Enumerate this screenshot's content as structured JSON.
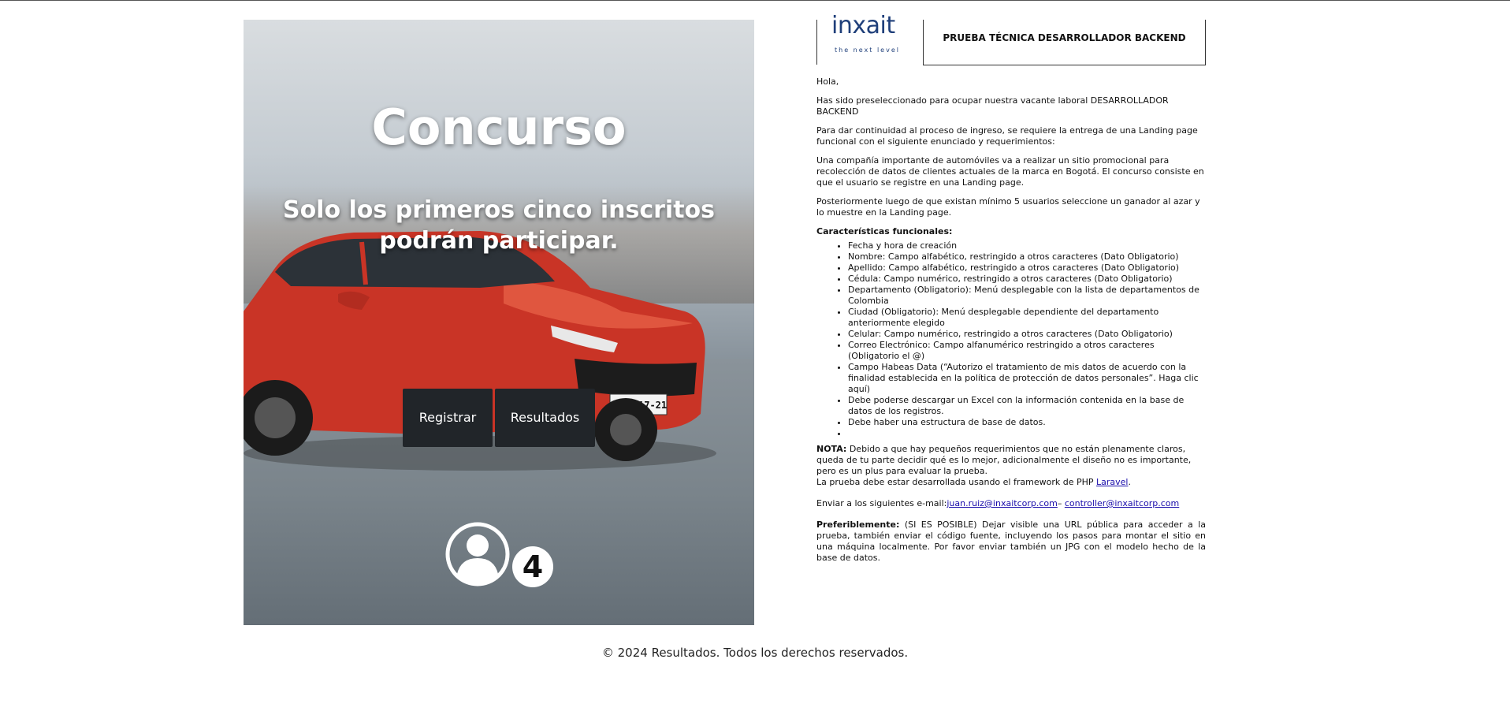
{
  "hero": {
    "title": "Concurso",
    "subtitle": "Solo los primeros cinco inscritos podrán participar.",
    "register_label": "Registrar",
    "results_label": "Resultados",
    "participant_count": "4",
    "plate_text": "ONX 517-21"
  },
  "doc": {
    "logo_text": "inxait",
    "logo_tagline": "the next level",
    "header_title": "PRUEBA TÉCNICA DESARROLLADOR BACKEND",
    "greeting": "Hola,",
    "p1": "Has sido preseleccionado para ocupar nuestra vacante laboral DESARROLLADOR BACKEND",
    "p2": "Para dar continuidad al proceso de ingreso, se requiere la entrega de una Landing page funcional con el siguiente enunciado y requerimientos:",
    "p3": "Una compañía importante de automóviles va a realizar un sitio promocional para recolección de datos de clientes actuales de la marca en Bogotá. El concurso consiste en que el usuario se registre en una Landing page.",
    "p4": "Posteriormente luego de que existan mínimo 5 usuarios seleccione un ganador al azar y lo muestre en la Landing page.",
    "features_title": "Características funcionales:",
    "features": [
      "Fecha y hora de creación",
      "Nombre: Campo alfabético, restringido a otros caracteres (Dato Obligatorio)",
      "Apellido: Campo alfabético, restringido a otros caracteres (Dato Obligatorio)",
      "Cédula: Campo numérico, restringido a otros caracteres (Dato Obligatorio)",
      "Departamento (Obligatorio): Menú desplegable con la lista de departamentos de Colombia",
      "Ciudad (Obligatorio): Menú desplegable dependiente del departamento anteriormente elegido",
      "Celular: Campo numérico, restringido a otros caracteres (Dato Obligatorio)",
      "Correo Electrónico: Campo alfanumérico restringido a otros caracteres (Obligatorio el @)",
      "Campo Habeas Data (“Autorizo el tratamiento de mis datos de acuerdo con la finalidad establecida en la política de protección de datos personales”. Haga clic aquí)",
      "Debe poderse descargar un Excel con la información contenida en la base de datos de los registros.",
      "Debe haber una estructura de base de datos.",
      ""
    ],
    "nota_label": "NOTA:",
    "nota_text": " Debido a que hay pequeños requerimientos que no están plenamente claros, queda de tu parte decidir qué es lo mejor, adicionalmente el diseño no es importante, pero es un plus para evaluar la prueba.",
    "framework_prefix": "La prueba debe estar desarrollada usando el framework de PHP ",
    "framework_link": "Laravel",
    "framework_suffix": ".",
    "send_prefix": "Enviar a los siguientes e-mail:",
    "email1": "juan.ruiz@inxaitcorp.com",
    "email_sep": "– ",
    "email2": "controller@inxaitcorp.com",
    "pref_label": "Preferiblemente:",
    "pref_text": " (SI ES POSIBLE) Dejar visible una URL pública para acceder a la prueba, también enviar el código fuente, incluyendo los pasos para montar el sitio en una máquina localmente. Por favor enviar también un JPG con el modelo hecho de la base de datos."
  },
  "footer": {
    "text": "© 2024 Resultados. Todos los derechos reservados."
  },
  "colors": {
    "button_bg": "#212529",
    "logo_blue": "#1f3f7a",
    "car_red": "#d23a2a",
    "link": "#1a0dab"
  }
}
